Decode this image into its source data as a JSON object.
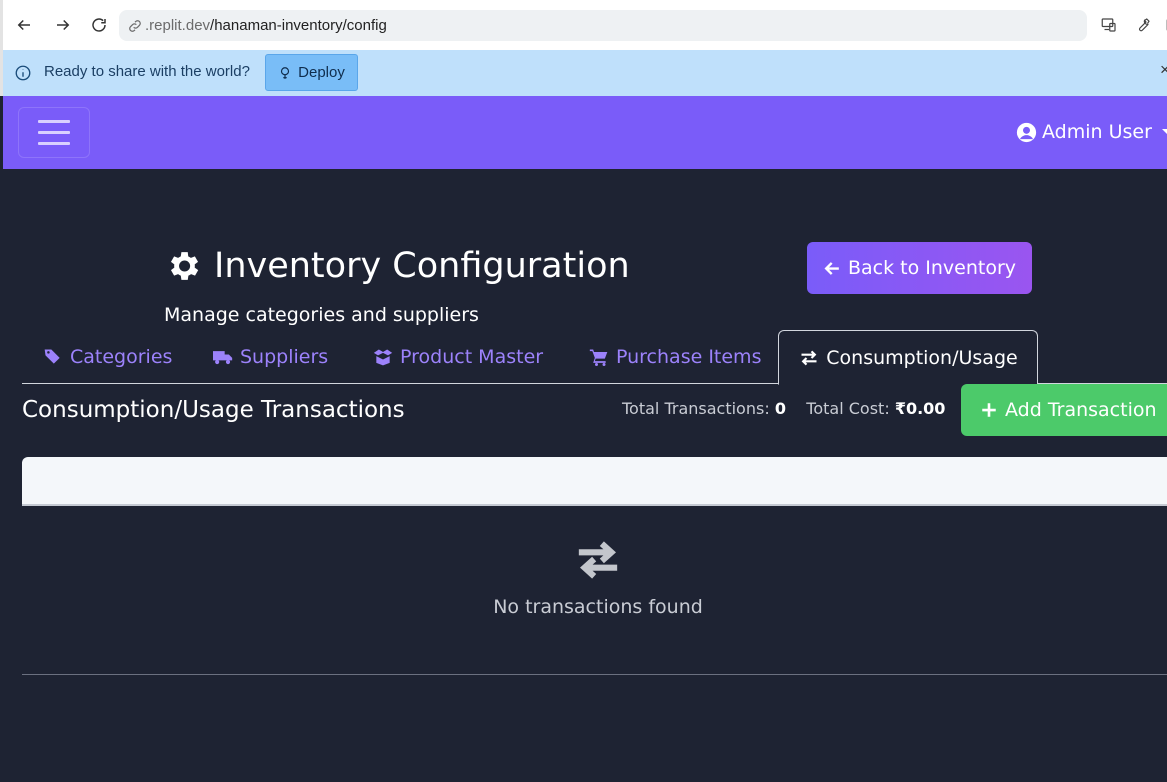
{
  "browser": {
    "url_host": ".replit.dev",
    "url_path": "/hanaman-inventory/config"
  },
  "infobar": {
    "message": "Ready to share with the world?",
    "deploy_label": "Deploy",
    "close_label": "×"
  },
  "navbar": {
    "user_label": "Admin User"
  },
  "header": {
    "title": "Inventory Configuration",
    "subtitle": "Manage categories and suppliers",
    "back_label": "Back to Inventory"
  },
  "tabs": [
    {
      "label": "Categories",
      "icon": "tags-icon",
      "active": false
    },
    {
      "label": "Suppliers",
      "icon": "truck-icon",
      "active": false
    },
    {
      "label": "Product Master",
      "icon": "box-open-icon",
      "active": false
    },
    {
      "label": "Purchase Items",
      "icon": "cart-icon",
      "active": false
    },
    {
      "label": "Consumption/Usage",
      "icon": "exchange-icon",
      "active": true
    }
  ],
  "section": {
    "title": "Consumption/Usage Transactions",
    "total_transactions_label": "Total Transactions:",
    "total_transactions_value": "0",
    "total_cost_label": "Total Cost:",
    "total_cost_value": "₹0.00",
    "add_label": "Add Transaction"
  },
  "table": {
    "empty_message": "No transactions found"
  },
  "colors": {
    "navbar": "#7a5cf9",
    "background": "#1e2333",
    "accent_link": "#9c82fb",
    "success": "#4cca6a",
    "infobar": "#bfe0fb"
  }
}
